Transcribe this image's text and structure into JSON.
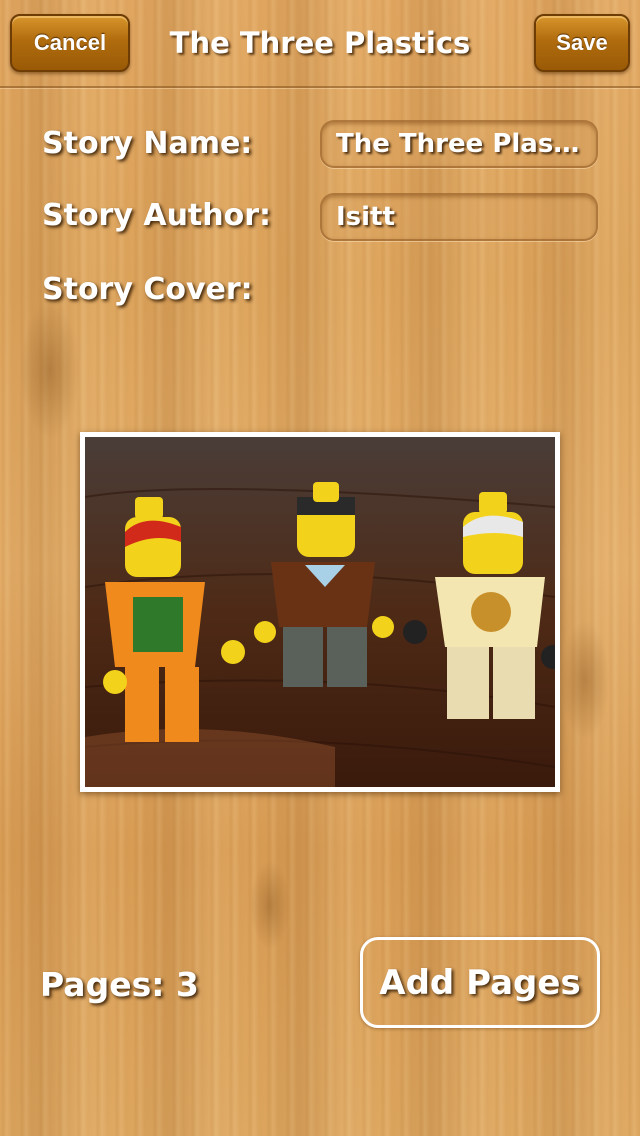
{
  "navbar": {
    "cancel_label": "Cancel",
    "title": "The Three Plastics",
    "save_label": "Save"
  },
  "form": {
    "story_name_label": "Story Name:",
    "story_name_value": "The Three Plas...",
    "story_author_label": "Story Author:",
    "story_author_value": "Isitt",
    "story_cover_label": "Story Cover:"
  },
  "footer": {
    "pages_text": "Pages: 3",
    "add_pages_label": "Add Pages"
  },
  "colors": {
    "wood": "#dea760",
    "button_brown": "#b06c0e",
    "text": "#ffffff"
  }
}
